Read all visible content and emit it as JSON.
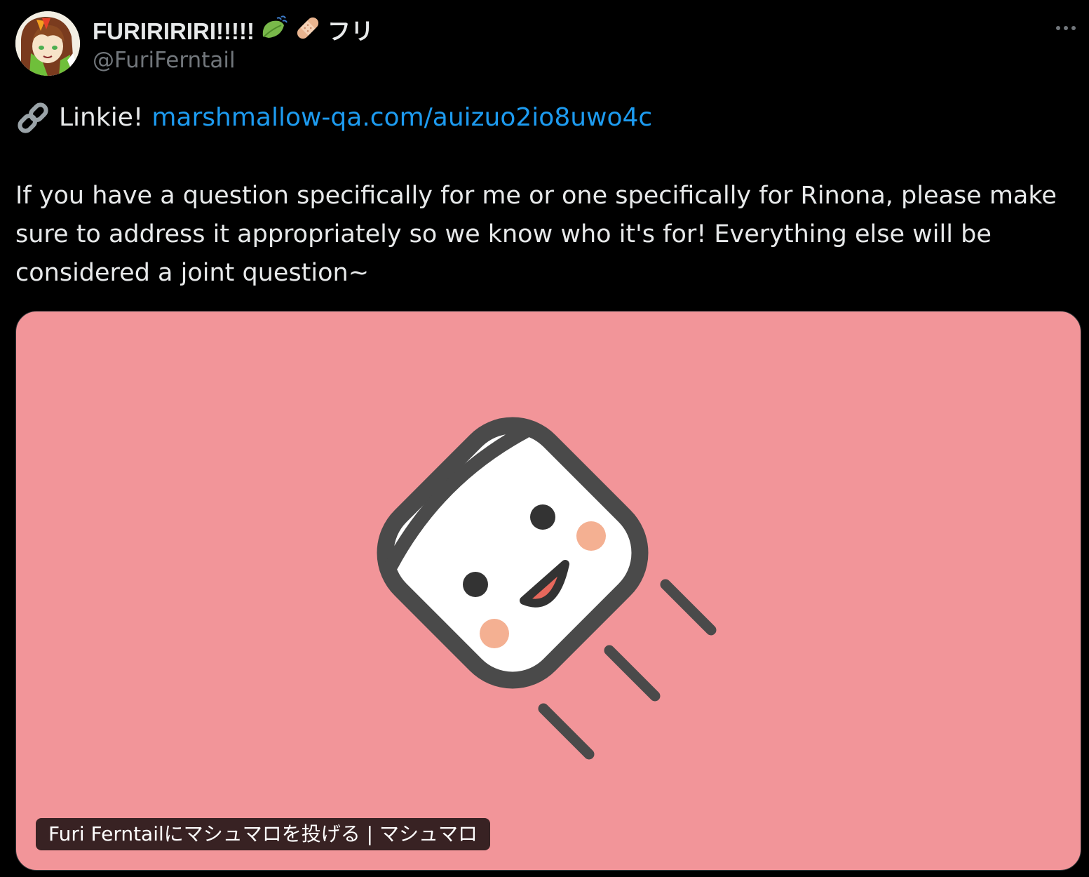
{
  "post": {
    "author": {
      "display_name": "FURIRIRIRI!!!!!",
      "name_emoji": [
        "leaf-icon",
        "bandage-icon"
      ],
      "name_suffix": "フリ",
      "handle": "@FuriFerntail"
    },
    "link_prefix": "Linkie!",
    "link_url_text": "marshmallow-qa.com/auizuo2io8uwo4c",
    "body": "If you have a question specifically for me or one specifically for Rinona, please make sure to address it appropriately so we know who it's for! Everything else will be considered a joint question~",
    "card": {
      "caption": "Furi Ferntailにマシュマロを投げる | マシュマロ",
      "background_color": "#f29599",
      "image": "marshmallow-mascot"
    }
  },
  "colors": {
    "background": "#000000",
    "text_primary": "#e7e9ea",
    "text_secondary": "#71767b",
    "link": "#1d9bf0"
  }
}
